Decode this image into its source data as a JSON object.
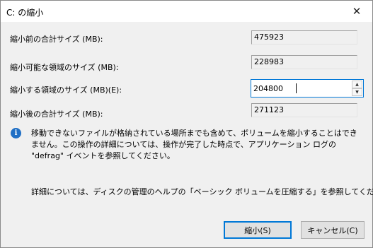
{
  "window": {
    "title": "C: の縮小",
    "close_icon": "close-icon"
  },
  "fields": {
    "total_before": {
      "label": "縮小前の合計サイズ (MB):",
      "value": "475923"
    },
    "available": {
      "label": "縮小可能な領域のサイズ (MB):",
      "value": "228983"
    },
    "shrink_amount": {
      "label": "縮小する領域のサイズ (MB)(E):",
      "value": "204800"
    },
    "total_after": {
      "label": "縮小後の合計サイズ (MB):",
      "value": "271123"
    }
  },
  "info": {
    "icon": "info-icon",
    "text": "移動できないファイルが格納されている場所までも含めて、ボリュームを縮小することはできません。この操作の詳細については、操作が完了した時点で、アプリケーション ログの \"defrag\" イベントを参照してください。"
  },
  "help_text": "詳細については、ディスクの管理のヘルプの「ベーシック ボリュームを圧縮する」を参照してください",
  "buttons": {
    "shrink": "縮小(S)",
    "cancel": "キャンセル(C)"
  },
  "colors": {
    "accent": "#0078d7",
    "info_icon": "#1f6fc5"
  }
}
